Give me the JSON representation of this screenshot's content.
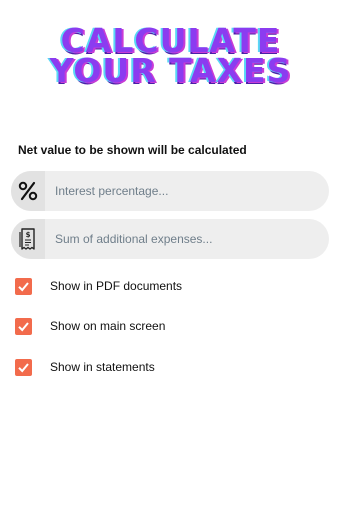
{
  "banner": {
    "line1": "CALCULATE",
    "line2": "YOUR TAXES"
  },
  "subtitle": "Net value to be shown will be calculated",
  "fields": [
    {
      "icon": "percent-icon",
      "placeholder": "Interest percentage..."
    },
    {
      "icon": "receipt-icon",
      "placeholder": "Sum of additional expenses..."
    }
  ],
  "options": [
    {
      "label": "Show in PDF documents",
      "checked": true
    },
    {
      "label": "Show on main screen",
      "checked": true
    },
    {
      "label": "Show in statements",
      "checked": true
    }
  ],
  "colors": {
    "accent": "#f26b4c",
    "banner_fill": "#8b3cf0",
    "field_background": "#eeeeee"
  }
}
